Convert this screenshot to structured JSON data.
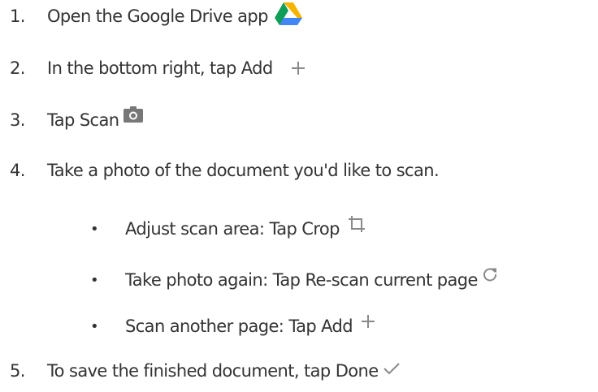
{
  "steps": [
    {
      "number": "1.",
      "text": "Open the Google Drive app",
      "icon": "google-drive-icon"
    },
    {
      "number": "2.",
      "text": "In the bottom right, tap Add",
      "icon": "plus-icon"
    },
    {
      "number": "3.",
      "text": "Tap Scan",
      "icon": "camera-icon"
    },
    {
      "number": "4.",
      "text": "Take a photo of the document you'd like to scan.",
      "substeps": [
        {
          "bullet": "•",
          "text": "Adjust scan area: Tap Crop",
          "icon": "crop-icon"
        },
        {
          "bullet": "•",
          "text": "Take photo again: Tap Re-scan current page",
          "icon": "refresh-icon"
        },
        {
          "bullet": "•",
          "text": "Scan another page: Tap Add",
          "icon": "plus-icon"
        }
      ]
    },
    {
      "number": "5.",
      "text": "To save the finished document, tap Done",
      "icon": "checkmark-icon"
    }
  ],
  "colors": {
    "text": "#333333",
    "icon_gray": "#8a8a8a",
    "drive_green": "#0f9d58",
    "drive_yellow": "#f4b400",
    "drive_blue": "#4285f4"
  }
}
